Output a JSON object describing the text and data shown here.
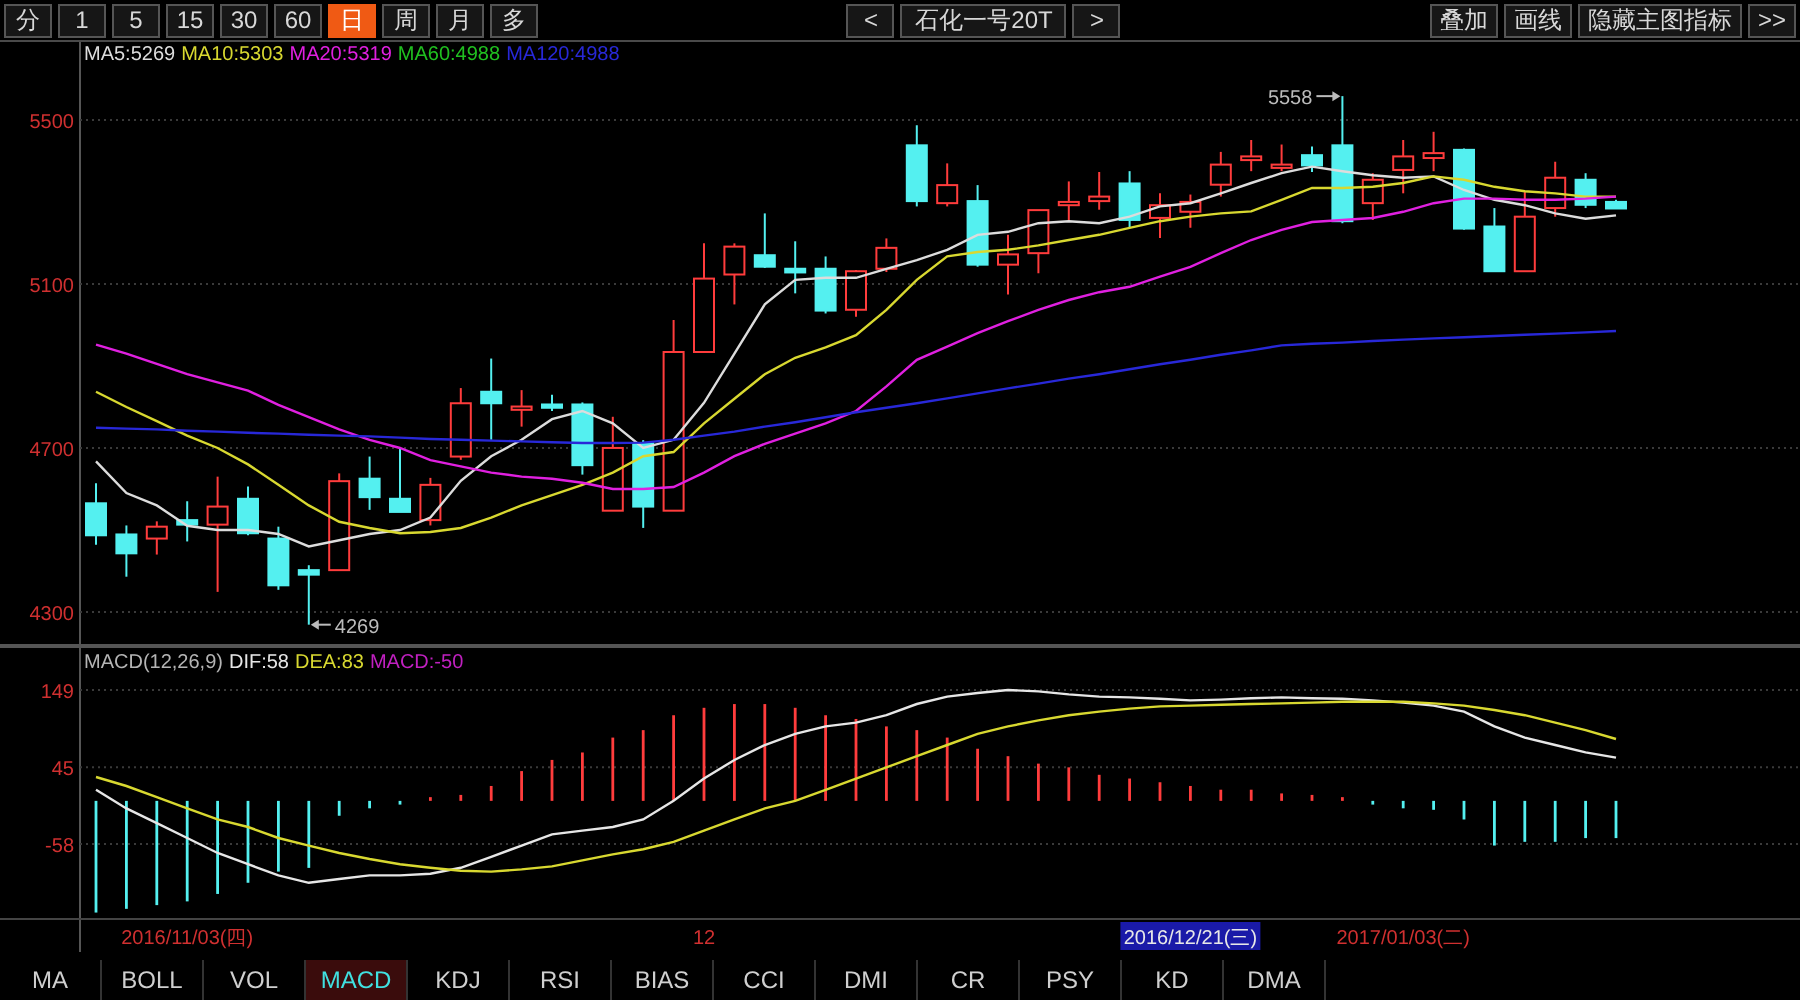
{
  "toolbar": {
    "periods": [
      {
        "label": "分",
        "selected": false
      },
      {
        "label": "1",
        "selected": false
      },
      {
        "label": "5",
        "selected": false
      },
      {
        "label": "15",
        "selected": false
      },
      {
        "label": "30",
        "selected": false
      },
      {
        "label": "60",
        "selected": false
      },
      {
        "label": "日",
        "selected": true
      },
      {
        "label": "周",
        "selected": false
      },
      {
        "label": "月",
        "selected": false
      },
      {
        "label": "多",
        "selected": false
      }
    ],
    "prev": "<",
    "symbol": "石化一号20T",
    "next": ">",
    "actions": [
      "叠加",
      "画线",
      "隐藏主图指标",
      ">>"
    ]
  },
  "main_chart": {
    "high_label": "5558",
    "low_label": "4269",
    "candles": {
      "chart_data": {
        "type": "candlestick",
        "grid": true,
        "categories": [
          null,
          null,
          null,
          null,
          null,
          null,
          null,
          null,
          null,
          null,
          null,
          null,
          null,
          null,
          null,
          null,
          null,
          null,
          null,
          null,
          null,
          null,
          null,
          null,
          null,
          null,
          null,
          null,
          null,
          null,
          null,
          null,
          null,
          null,
          null,
          null,
          null,
          null,
          null,
          null,
          null,
          null,
          null,
          null,
          null,
          null,
          null,
          null,
          null,
          null,
          null
        ],
        "ylim": [
          4217,
          5690
        ],
        "yticks": [
          4300,
          4700,
          5100,
          5500
        ],
        "ohlc": [
          [
            4565,
            4614,
            4464,
            4487
          ],
          [
            4489,
            4511,
            4386,
            4443
          ],
          [
            4479,
            4521,
            4440,
            4508
          ],
          [
            4524,
            4570,
            4472,
            4513
          ],
          [
            4513,
            4630,
            4349,
            4557
          ],
          [
            4576,
            4606,
            4487,
            4492
          ],
          [
            4479,
            4508,
            4354,
            4365
          ],
          [
            4402,
            4414,
            4269,
            4391
          ],
          [
            4402,
            4638,
            4402,
            4619
          ],
          [
            4625,
            4679,
            4549,
            4580
          ],
          [
            4576,
            4698,
            4544,
            4544
          ],
          [
            4524,
            4627,
            4511,
            4610
          ],
          [
            4679,
            4846,
            4671,
            4809
          ],
          [
            4837,
            4918,
            4720,
            4809
          ],
          [
            4793,
            4841,
            4752,
            4801
          ],
          [
            4806,
            4830,
            4790,
            4798
          ],
          [
            4806,
            4811,
            4635,
            4658
          ],
          [
            4547,
            4776,
            4547,
            4700
          ],
          [
            4711,
            4719,
            4505,
            4557
          ],
          [
            4547,
            5012,
            4547,
            4934
          ],
          [
            4934,
            5199,
            4934,
            5113
          ],
          [
            5123,
            5199,
            5050,
            5191
          ],
          [
            5170,
            5272,
            5139,
            5142
          ],
          [
            5137,
            5204,
            5077,
            5128
          ],
          [
            5137,
            5167,
            5028,
            5035
          ],
          [
            5037,
            5134,
            5020,
            5131
          ],
          [
            5137,
            5211,
            5129,
            5188
          ],
          [
            5438,
            5487,
            5289,
            5302
          ],
          [
            5297,
            5394,
            5289,
            5341
          ],
          [
            5302,
            5341,
            5142,
            5147
          ],
          [
            5147,
            5220,
            5074,
            5172
          ],
          [
            5175,
            5280,
            5126,
            5280
          ],
          [
            5292,
            5350,
            5251,
            5300
          ],
          [
            5302,
            5373,
            5281,
            5313
          ],
          [
            5345,
            5375,
            5237,
            5256
          ],
          [
            5261,
            5321,
            5212,
            5292
          ],
          [
            5276,
            5318,
            5237,
            5300
          ],
          [
            5342,
            5422,
            5313,
            5391
          ],
          [
            5402,
            5451,
            5375,
            5411
          ],
          [
            5383,
            5440,
            5375,
            5391
          ],
          [
            5414,
            5435,
            5373,
            5389
          ],
          [
            5438,
            5558,
            5248,
            5253
          ],
          [
            5297,
            5370,
            5256,
            5354
          ],
          [
            5378,
            5451,
            5321,
            5411
          ],
          [
            5407,
            5471,
            5375,
            5419
          ],
          [
            5427,
            5430,
            5232,
            5235
          ],
          [
            5240,
            5285,
            5131,
            5131
          ],
          [
            5131,
            5324,
            5131,
            5264
          ],
          [
            5285,
            5398,
            5264,
            5359
          ],
          [
            5354,
            5370,
            5285,
            5293
          ],
          [
            5300,
            5305,
            5284,
            5284
          ]
        ]
      }
    },
    "chart_data": {
      "type": "line",
      "categories": [
        null,
        null,
        null,
        null,
        null,
        null,
        null,
        null,
        null,
        null,
        null,
        null,
        null,
        null,
        null,
        null,
        null,
        null,
        null,
        null,
        null,
        null,
        null,
        null,
        null,
        null,
        null,
        null,
        null,
        null,
        null,
        null,
        null,
        null,
        null,
        null,
        null,
        null,
        null,
        null,
        null,
        null,
        null,
        null,
        null,
        null,
        null,
        null,
        null,
        null,
        null
      ],
      "ylim": [
        4217,
        5690
      ],
      "series": [
        {
          "name": "MA5:5269",
          "color": "#dcdcdc",
          "values": [
            4667,
            4590,
            4560,
            4510,
            4500,
            4500,
            4490,
            4460,
            4475,
            4490,
            4500,
            4530,
            4620,
            4680,
            4720,
            4770,
            4790,
            4760,
            4700,
            4720,
            4810,
            4930,
            5050,
            5110,
            5115,
            5115,
            5137,
            5158,
            5183,
            5220,
            5227,
            5248,
            5253,
            5248,
            5264,
            5289,
            5297,
            5321,
            5346,
            5370,
            5386,
            5375,
            5365,
            5359,
            5362,
            5329,
            5305,
            5292,
            5272,
            5259,
            5267
          ]
        },
        {
          "name": "MA10:5303",
          "color": "#d8d830",
          "values": [
            4837,
            4800,
            4765,
            4730,
            4700,
            4660,
            4610,
            4560,
            4520,
            4505,
            4492,
            4495,
            4505,
            4530,
            4560,
            4585,
            4610,
            4640,
            4680,
            4690,
            4760,
            4820,
            4880,
            4920,
            4945,
            4975,
            5037,
            5110,
            5167,
            5178,
            5183,
            5194,
            5207,
            5220,
            5237,
            5253,
            5264,
            5272,
            5277,
            5305,
            5334,
            5334,
            5337,
            5346,
            5362,
            5354,
            5337,
            5326,
            5321,
            5313,
            5313
          ]
        },
        {
          "name": "MA20:5319",
          "color": "#e020e0",
          "values": [
            4952,
            4930,
            4905,
            4880,
            4860,
            4840,
            4805,
            4775,
            4745,
            4720,
            4700,
            4670,
            4655,
            4640,
            4630,
            4625,
            4615,
            4600,
            4600,
            4605,
            4640,
            4680,
            4710,
            4735,
            4760,
            4790,
            4850,
            4915,
            4947,
            4980,
            5009,
            5037,
            5061,
            5080,
            5093,
            5118,
            5142,
            5175,
            5207,
            5232,
            5251,
            5256,
            5261,
            5276,
            5297,
            5308,
            5308,
            5305,
            5305,
            5308,
            5313
          ]
        },
        {
          "name": "MA60:4988",
          "color": "#20c020",
          "values": [
            null,
            null,
            null,
            null,
            null,
            null,
            null,
            null,
            null,
            null,
            null,
            null,
            null,
            null,
            null,
            null,
            null,
            null,
            null,
            null,
            null,
            null,
            null,
            null,
            null,
            null,
            null,
            null,
            null,
            null,
            null,
            null,
            null,
            null,
            null,
            null,
            null,
            null,
            null,
            null,
            null,
            null,
            null,
            null,
            null,
            null,
            null,
            null,
            null,
            null,
            null
          ]
        },
        {
          "name": "MA120:4988",
          "color": "#2828d8",
          "values": [
            4749,
            4747,
            4745,
            4742,
            4740,
            4737,
            4735,
            4732,
            4730,
            4728,
            4725,
            4722,
            4720,
            4718,
            4716,
            4714,
            4712,
            4712,
            4713,
            4720,
            4730,
            4740,
            4752,
            4763,
            4775,
            4787,
            4798,
            4809,
            4821,
            4833,
            4845,
            4857,
            4869,
            4880,
            4892,
            4904,
            4915,
            4927,
            4938,
            4950,
            4954,
            4957,
            4961,
            4964,
            4967,
            4970,
            4973,
            4976,
            4979,
            4982,
            4985
          ]
        }
      ]
    }
  },
  "macd_chart": {
    "histogram": {
      "chart_data": {
        "type": "bar",
        "title": "MACD(12,26,9)",
        "grid": true,
        "categories": [
          null,
          null,
          null,
          "2016/11/03(四)",
          null,
          null,
          null,
          null,
          null,
          null,
          null,
          null,
          null,
          null,
          null,
          null,
          null,
          null,
          null,
          null,
          "12",
          null,
          null,
          null,
          null,
          null,
          null,
          null,
          null,
          null,
          null,
          null,
          null,
          null,
          null,
          null,
          "2016/12/21(三)",
          null,
          null,
          null,
          null,
          null,
          null,
          "2017/01/03(二)",
          null,
          null,
          null,
          null,
          null,
          null,
          null
        ],
        "ylim": [
          -160,
          208
        ],
        "yticks": [
          -58,
          45,
          149
        ],
        "series": [
          {
            "name": "MACD:-50",
            "values": [
              -150,
              -145,
              -140,
              -135,
              -125,
              -110,
              -95,
              -90,
              -20,
              -10,
              -5,
              5,
              8,
              20,
              40,
              55,
              65,
              85,
              95,
              115,
              125,
              130,
              130,
              125,
              115,
              110,
              100,
              95,
              85,
              70,
              60,
              50,
              45,
              35,
              30,
              25,
              20,
              15,
              15,
              10,
              8,
              5,
              -5,
              -10,
              -12,
              -25,
              -60,
              -55,
              -55,
              -50,
              -50
            ]
          }
        ]
      }
    },
    "lines": {
      "chart_data": {
        "type": "line",
        "categories": [
          null,
          null,
          null,
          null,
          null,
          null,
          null,
          null,
          null,
          null,
          null,
          null,
          null,
          null,
          null,
          null,
          null,
          null,
          null,
          null,
          null,
          null,
          null,
          null,
          null,
          null,
          null,
          null,
          null,
          null,
          null,
          null,
          null,
          null,
          null,
          null,
          null,
          null,
          null,
          null,
          null,
          null,
          null,
          null,
          null,
          null,
          null,
          null,
          null,
          null,
          null
        ],
        "ylim": [
          -160,
          208
        ],
        "series": [
          {
            "name": "DIF:58",
            "color": "#e6e6e6",
            "values": [
              15,
              -10,
              -30,
              -50,
              -70,
              -85,
              -100,
              -110,
              -105,
              -100,
              -100,
              -98,
              -90,
              -75,
              -60,
              -45,
              -40,
              -35,
              -25,
              0,
              30,
              55,
              75,
              90,
              100,
              105,
              115,
              130,
              140,
              145,
              149,
              147,
              143,
              140,
              139,
              137,
              135,
              136,
              138,
              139,
              138,
              137,
              135,
              132,
              128,
              120,
              100,
              85,
              75,
              65,
              58
            ]
          },
          {
            "name": "DEA:83",
            "color": "#d8d830",
            "values": [
              32,
              20,
              5,
              -10,
              -25,
              -35,
              -50,
              -60,
              -70,
              -78,
              -85,
              -90,
              -94,
              -95,
              -92,
              -88,
              -80,
              -72,
              -65,
              -55,
              -40,
              -25,
              -10,
              0,
              15,
              30,
              45,
              60,
              75,
              90,
              100,
              108,
              115,
              120,
              124,
              127,
              128,
              129,
              130,
              131,
              132,
              133,
              133,
              133,
              131,
              128,
              122,
              115,
              105,
              95,
              83
            ]
          }
        ]
      }
    },
    "date_axis": [
      {
        "selected": false
      },
      {
        "selected": false
      },
      {
        "selected": true
      },
      {
        "selected": false
      }
    ]
  },
  "indicator_tabs": [
    {
      "label": "MA",
      "selected": false
    },
    {
      "label": "BOLL",
      "selected": false
    },
    {
      "label": "VOL",
      "selected": false
    },
    {
      "label": "MACD",
      "selected": true
    },
    {
      "label": "KDJ",
      "selected": false
    },
    {
      "label": "RSI",
      "selected": false
    },
    {
      "label": "BIAS",
      "selected": false
    },
    {
      "label": "CCI",
      "selected": false
    },
    {
      "label": "DMI",
      "selected": false
    },
    {
      "label": "CR",
      "selected": false
    },
    {
      "label": "PSY",
      "selected": false
    },
    {
      "label": "KD",
      "selected": false
    },
    {
      "label": "DMA",
      "selected": false
    }
  ]
}
